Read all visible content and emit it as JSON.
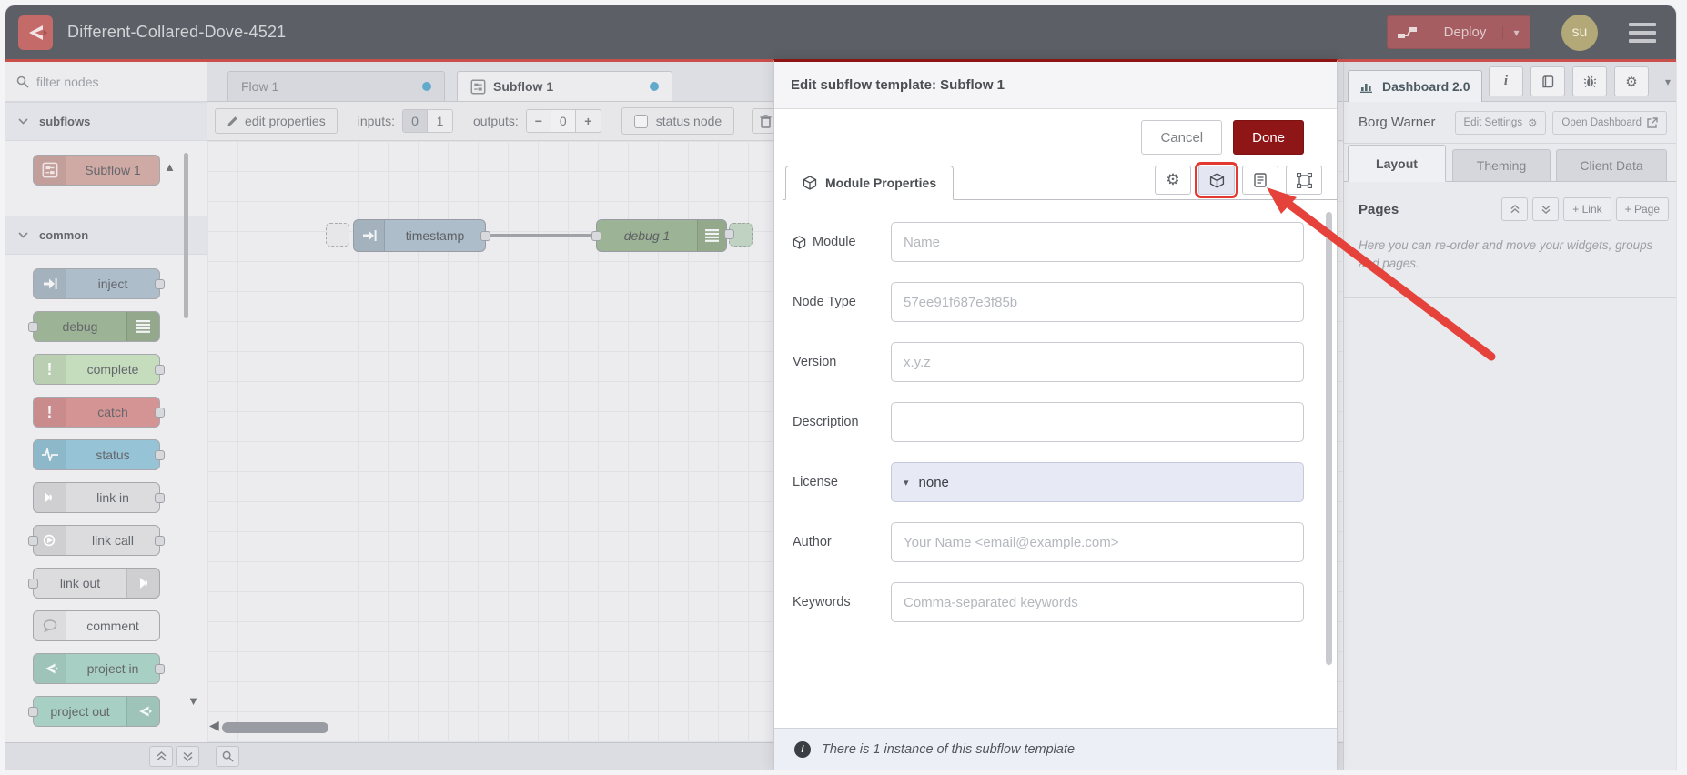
{
  "icons": {
    "gear": "⚙",
    "caret_down": "▾",
    "triangle_up": "▲",
    "triangle_down": "▼",
    "triangle_left": "◀",
    "bang": "!",
    "info": "i",
    "plus": "+",
    "minus": "−"
  },
  "header": {
    "title": "Different-Collared-Dove-4521",
    "deploy_label": "Deploy",
    "avatar_initials": "su"
  },
  "palette": {
    "filter_placeholder": "filter nodes",
    "categories": [
      {
        "label": "subflows",
        "nodes": [
          {
            "label": "Subflow 1"
          }
        ]
      },
      {
        "label": "common",
        "nodes": [
          {
            "label": "inject"
          },
          {
            "label": "debug"
          },
          {
            "label": "complete"
          },
          {
            "label": "catch"
          },
          {
            "label": "status"
          },
          {
            "label": "link in"
          },
          {
            "label": "link call"
          },
          {
            "label": "link out"
          },
          {
            "label": "comment"
          },
          {
            "label": "project in"
          },
          {
            "label": "project out"
          }
        ]
      }
    ]
  },
  "workspace": {
    "tabs": [
      {
        "label": "Flow 1"
      },
      {
        "label": "Subflow 1"
      }
    ],
    "toolbar": {
      "edit_properties_label": "edit properties",
      "inputs_label": "inputs:",
      "input_options": [
        "0",
        "1"
      ],
      "outputs_label": "outputs:",
      "outputs_value": "0",
      "status_node_label": "status node"
    },
    "nodes": {
      "timestamp_label": "timestamp",
      "debug_label": "debug 1"
    }
  },
  "dialog": {
    "title": "Edit subflow template: Subflow 1",
    "cancel_label": "Cancel",
    "done_label": "Done",
    "tab_label": "Module Properties",
    "fields": [
      {
        "label": "Module",
        "placeholder": "Name"
      },
      {
        "label": "Node Type",
        "placeholder": "57ee91f687e3f85b"
      },
      {
        "label": "Version",
        "placeholder": "x.y.z"
      },
      {
        "label": "Description",
        "placeholder": ""
      },
      {
        "label": "License",
        "value": "none"
      },
      {
        "label": "Author",
        "placeholder": "Your Name <email@example.com>"
      },
      {
        "label": "Keywords",
        "placeholder": "Comma-separated keywords"
      }
    ],
    "footer_text": "There is 1 instance of this subflow template"
  },
  "sidebar": {
    "tab_label": "Dashboard 2.0",
    "project_name": "Borg Warner",
    "edit_settings_label": "Edit Settings",
    "open_dashboard_label": "Open Dashboard",
    "tabs": [
      {
        "label": "Layout"
      },
      {
        "label": "Theming"
      },
      {
        "label": "Client Data"
      }
    ],
    "pages_label": "Pages",
    "add_link_label": "+ Link",
    "add_page_label": "+ Page",
    "help_text": "Here you can re-order and move your widgets, groups and pages."
  }
}
